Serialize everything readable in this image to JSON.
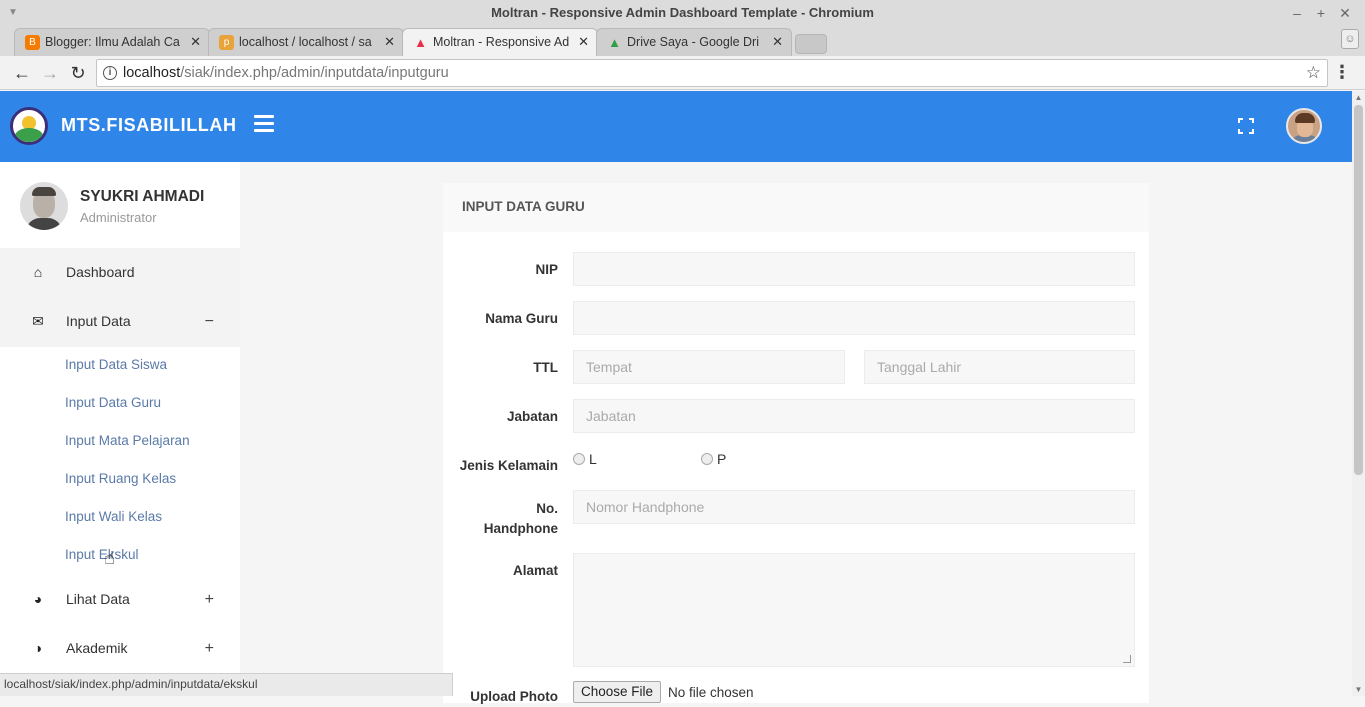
{
  "window": {
    "title": "Moltran - Responsive Admin Dashboard Template - Chromium"
  },
  "tabs": [
    {
      "label": "Blogger: Ilmu Adalah Ca",
      "favicon_color": "#f57c00"
    },
    {
      "label": "localhost / localhost / sa",
      "favicon_color": "#e8a33a"
    },
    {
      "label": "Moltran - Responsive Ad",
      "favicon_color": "#e8304a"
    },
    {
      "label": "Drive Saya - Google Dri",
      "favicon_color": "#2f9e44"
    }
  ],
  "address": {
    "host": "localhost",
    "path": "/siak/index.php/admin/inputdata/inputguru"
  },
  "header": {
    "brand": "MTS.FISABILILLAH",
    "accent": "#2f86e8"
  },
  "user": {
    "name": "SYUKRI AHMADI",
    "role": "Administrator"
  },
  "sidebar": {
    "items": [
      {
        "label": "Dashboard",
        "icon": "home-icon"
      },
      {
        "label": "Input Data",
        "icon": "envelope-icon",
        "toggle": "−"
      },
      {
        "label": "Lihat Data",
        "icon": "palette-icon",
        "toggle": "+"
      },
      {
        "label": "Akademik",
        "icon": "contrast-icon",
        "toggle": "+"
      }
    ],
    "subitems": [
      "Input Data Siswa",
      "Input Data Guru",
      "Input Mata Pelajaran",
      "Input Ruang Kelas",
      "Input Wali Kelas",
      "Input Ekskul"
    ]
  },
  "form": {
    "heading": "INPUT DATA GURU",
    "nip_label": "NIP",
    "nama_label": "Nama Guru",
    "ttl_label": "TTL",
    "tempat_placeholder": "Tempat",
    "tanggal_placeholder": "Tanggal Lahir",
    "jabatan_label": "Jabatan",
    "jabatan_placeholder": "Jabatan",
    "jk_label": "Jenis Kelamain",
    "jk_option_l": "L",
    "jk_option_p": "P",
    "hp_label_1": "No.",
    "hp_label_2": "Handphone",
    "hp_placeholder": "Nomor Handphone",
    "alamat_label": "Alamat",
    "upload_label": "Upload Photo",
    "choose_file": "Choose File",
    "no_file": "No file chosen"
  },
  "status": {
    "url": "localhost/siak/index.php/admin/inputdata/ekskul"
  }
}
